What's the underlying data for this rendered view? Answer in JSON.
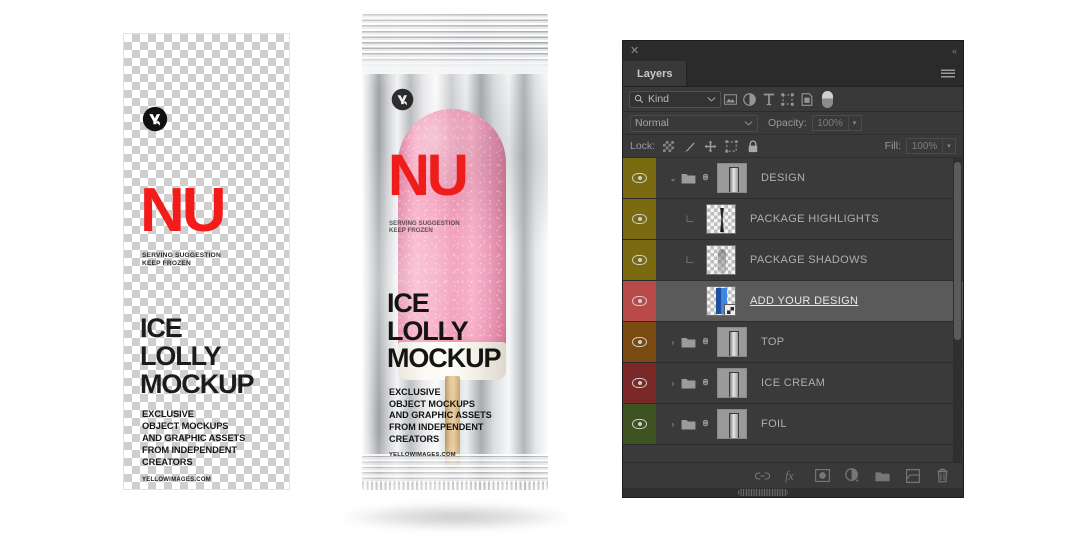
{
  "artwork": {
    "logo_icon": "yellowimages-logo-icon",
    "brand": "NU",
    "subline": "SERVING SUGGESTION\nKEEP FROZEN",
    "title": "ICE\nLOLLY\nMOCKUP",
    "body": "EXCLUSIVE\nOBJECT MOCKUPS\nAND GRAPHIC ASSETS\nFROM INDEPENDENT\nCREATORS",
    "url": "YELLOWIMAGES.COM",
    "brand_color": "#f41b1b",
    "text_color": "#1c1c1c"
  },
  "package": {
    "brand": "NU",
    "subline": "SERVING SUGGESTION\nKEEP FROZEN",
    "title": "ICE\nLOLLY\nMOCKUP",
    "body": "EXCLUSIVE\nOBJECT MOCKUPS\nAND GRAPHIC ASSETS\nFROM INDEPENDENT\nCREATORS",
    "url": "YELLOWIMAGES.COM",
    "lolly_color": "#f0a0bc",
    "foil_color": "#d5d7da",
    "stick_color": "#d9b988"
  },
  "panel": {
    "close_label": "✕",
    "collapse_label": "«",
    "tab_label": "Layers",
    "menu_icon": "hamburger-menu-icon",
    "filter": {
      "search_icon": "search-icon",
      "kind_label": "Kind",
      "chevron": "⌄",
      "icons": [
        {
          "name": "pixel-layer-filter-icon",
          "glyph": "image"
        },
        {
          "name": "adjustment-layer-filter-icon",
          "glyph": "adjustment"
        },
        {
          "name": "type-layer-filter-icon",
          "glyph": "T"
        },
        {
          "name": "shape-layer-filter-icon",
          "glyph": "shape"
        },
        {
          "name": "smart-object-filter-icon",
          "glyph": "smart"
        }
      ],
      "toggle_name": "filter-enable-toggle"
    },
    "blend": {
      "mode": "Normal",
      "chevron": "⌄",
      "opacity_label": "Opacity:",
      "opacity_value": "100%",
      "stepper": "⌄"
    },
    "lock": {
      "label": "Lock:",
      "icons": [
        {
          "name": "lock-transparent-pixels-icon"
        },
        {
          "name": "lock-image-pixels-icon"
        },
        {
          "name": "lock-position-icon"
        },
        {
          "name": "lock-artboard-nesting-icon"
        },
        {
          "name": "lock-all-icon"
        }
      ],
      "fill_label": "Fill:",
      "fill_value": "100%",
      "stepper": "⌄"
    },
    "layers": [
      {
        "name": "DESIGN",
        "color": "#7a6a10",
        "selected": false,
        "type": "group",
        "expanded": true,
        "arrow": "⌄",
        "has_folder": true,
        "has_link": true,
        "indent": 0,
        "thumb": "group",
        "clipped": false
      },
      {
        "name": "PACKAGE HIGHLIGHTS",
        "color": "#7a6a10",
        "selected": false,
        "type": "pixel",
        "arrow": "",
        "has_folder": false,
        "has_link": false,
        "indent": 1,
        "thumb": "highlights",
        "clipped": true
      },
      {
        "name": "PACKAGE SHADOWS",
        "color": "#7a6a10",
        "selected": false,
        "type": "pixel",
        "arrow": "",
        "has_folder": false,
        "has_link": false,
        "indent": 1,
        "thumb": "shadows",
        "clipped": true
      },
      {
        "name": "ADD YOUR DESIGN",
        "color": "#b94a4a",
        "selected": true,
        "type": "smart-object",
        "arrow": "",
        "has_folder": false,
        "has_link": false,
        "indent": 1,
        "thumb": "design",
        "clipped": false
      },
      {
        "name": "TOP",
        "color": "#7a4a10",
        "selected": false,
        "type": "group",
        "expanded": false,
        "arrow": "›",
        "has_folder": true,
        "has_link": true,
        "indent": 0,
        "thumb": "group",
        "clipped": false
      },
      {
        "name": "ICE CREAM",
        "color": "#7a2828",
        "selected": false,
        "type": "group",
        "expanded": false,
        "arrow": "›",
        "has_folder": true,
        "has_link": true,
        "indent": 0,
        "thumb": "group",
        "clipped": false
      },
      {
        "name": "FOIL",
        "color": "#3e5320",
        "selected": false,
        "type": "group",
        "expanded": false,
        "arrow": "›",
        "has_folder": true,
        "has_link": true,
        "indent": 0,
        "thumb": "group",
        "clipped": false
      }
    ],
    "bottom_bar": [
      {
        "name": "link-layers-button",
        "glyph": "link"
      },
      {
        "name": "layer-style-fx-button",
        "glyph": "fx"
      },
      {
        "name": "add-layer-mask-button",
        "glyph": "mask"
      },
      {
        "name": "new-adjustment-layer-button",
        "glyph": "adjustment"
      },
      {
        "name": "new-group-button",
        "glyph": "folder"
      },
      {
        "name": "new-layer-button",
        "glyph": "newlayer"
      },
      {
        "name": "delete-layer-button",
        "glyph": "trash"
      }
    ]
  }
}
